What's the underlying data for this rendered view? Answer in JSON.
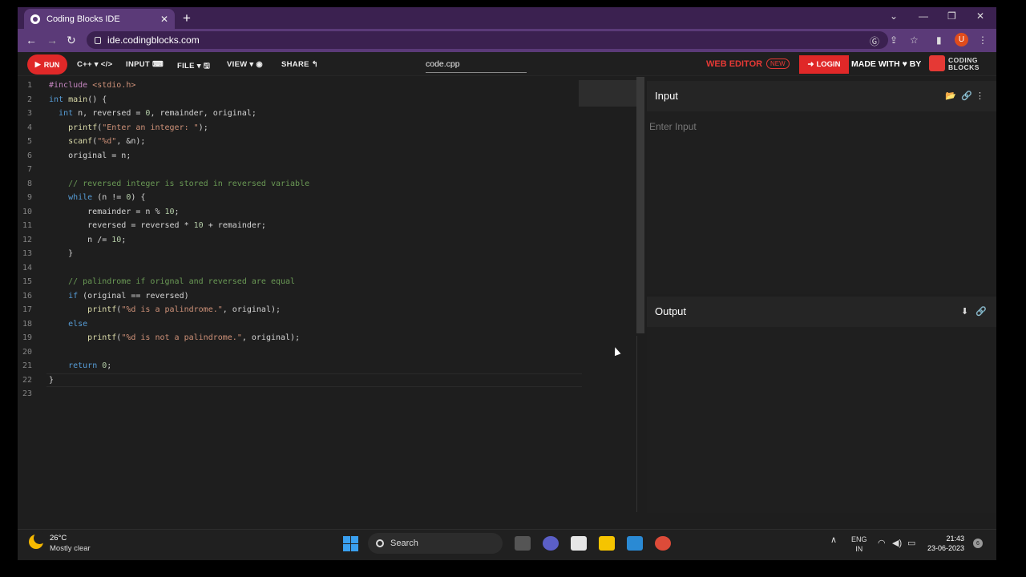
{
  "browser": {
    "tab_title": "Coding Blocks IDE",
    "url": "ide.codingblocks.com",
    "avatar_letter": "U"
  },
  "toolbar": {
    "run_label": "RUN",
    "lang_label": "C++ ▾ </>",
    "input_label": "INPUT ⌨",
    "file_label": "FILE ▾ 🖫",
    "view_label": "VIEW ▾ ◉",
    "share_label": "SHARE ↰",
    "filename": "code.cpp",
    "web_editor": "WEB EDITOR",
    "new_badge": "NEW",
    "login_label": "LOGIN",
    "made_with": "MADE WITH ♥ BY",
    "brand_line1": "CODING",
    "brand_line2": "BLOCKS"
  },
  "editor": {
    "line_numbers": [
      "1",
      "2",
      "3",
      "4",
      "5",
      "6",
      "7",
      "8",
      "9",
      "10",
      "11",
      "12",
      "13",
      "14",
      "15",
      "16",
      "17",
      "18",
      "19",
      "20",
      "21",
      "22",
      "23"
    ],
    "lines": [
      "#include <stdio.h>",
      "int main() {",
      "  int n, reversed = 0, remainder, original;",
      "    printf(\"Enter an integer: \");",
      "    scanf(\"%d\", &n);",
      "    original = n;",
      "",
      "    // reversed integer is stored in reversed variable",
      "    while (n != 0) {",
      "        remainder = n % 10;",
      "        reversed = reversed * 10 + remainder;",
      "        n /= 10;",
      "    }",
      "",
      "    // palindrome if orignal and reversed are equal",
      "    if (original == reversed)",
      "        printf(\"%d is a palindrome.\", original);",
      "    else",
      "        printf(\"%d is not a palindrome.\", original);",
      "",
      "    return 0;",
      "}",
      ""
    ]
  },
  "input_panel": {
    "title": "Input",
    "placeholder": "Enter Input"
  },
  "output_panel": {
    "title": "Output"
  },
  "taskbar": {
    "temperature": "26°C",
    "condition": "Mostly clear",
    "search_label": "Search",
    "lang_line1": "ENG",
    "lang_line2": "IN",
    "time": "21:43",
    "date": "23-06-2023",
    "notification_count": "6"
  }
}
